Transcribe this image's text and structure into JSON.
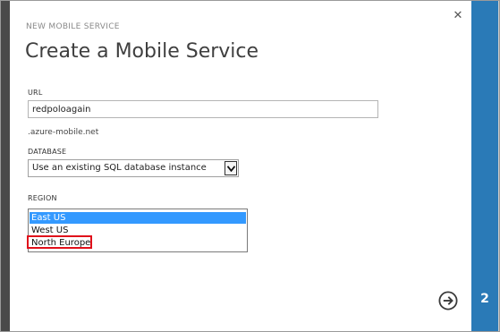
{
  "dialog": {
    "subtitle": "NEW MOBILE SERVICE",
    "title": "Create a Mobile Service",
    "close_icon": "close-icon"
  },
  "url": {
    "label": "URL",
    "value": "redpoloagain",
    "suffix": ".azure-mobile.net"
  },
  "database": {
    "label": "DATABASE",
    "selected": "Use an existing SQL database instance"
  },
  "region": {
    "label": "REGION",
    "options": [
      "East US",
      "West US",
      "North Europe"
    ],
    "selected": "East US",
    "highlighted": "North Europe",
    "highlight_color": "#e0101b"
  },
  "step": {
    "number": "2",
    "next_icon": "arrow-right-circle-icon",
    "bar_color": "#2a7ab7"
  }
}
